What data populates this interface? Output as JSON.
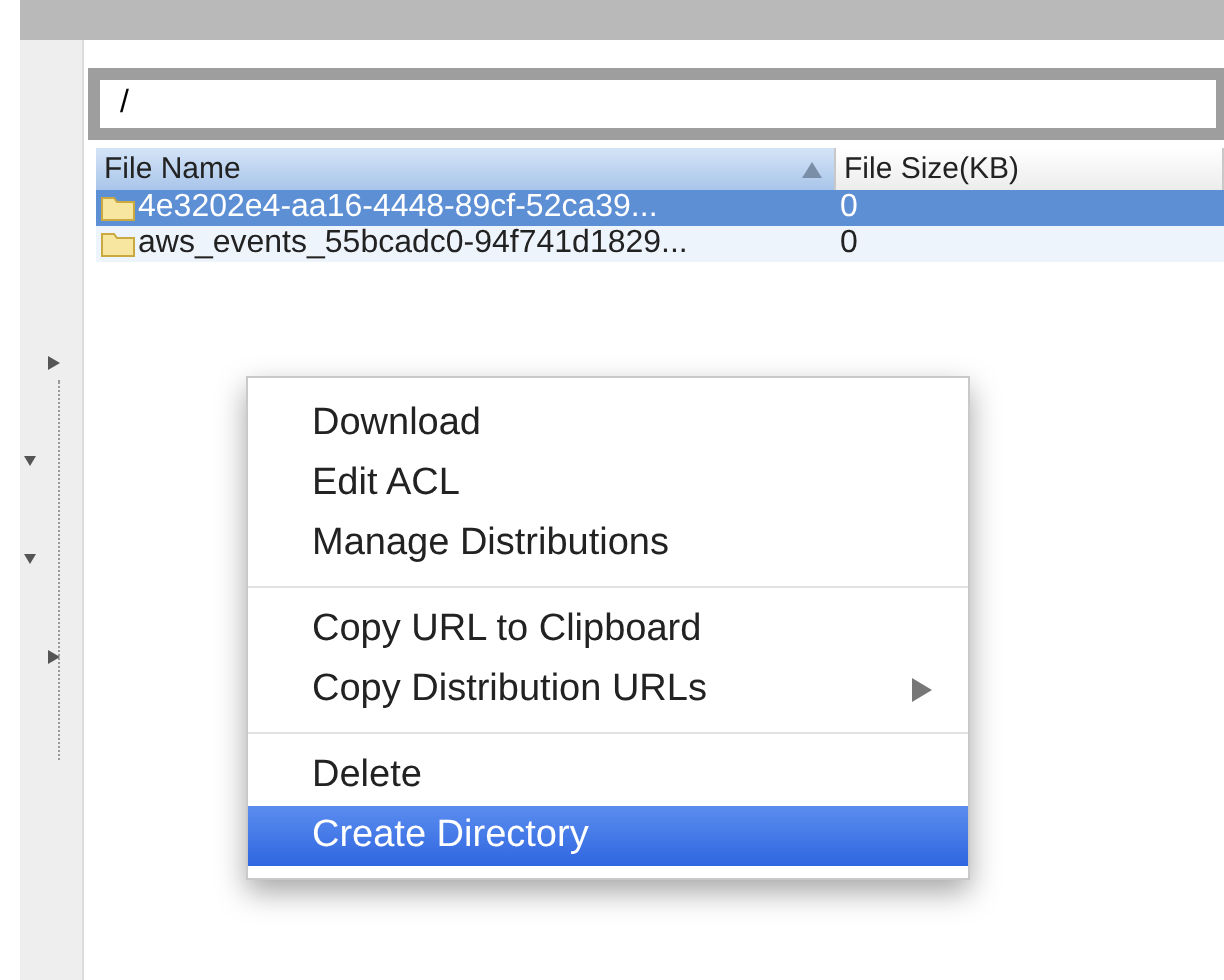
{
  "sidebar": {
    "toggles": [
      {
        "expanded": false
      },
      {
        "expanded": true
      },
      {
        "expanded": true
      },
      {
        "expanded": false
      }
    ]
  },
  "path_field": {
    "value": "/"
  },
  "table": {
    "columns": [
      {
        "label": "File Name",
        "sorted": true
      },
      {
        "label": "File Size(KB)",
        "sorted": false
      }
    ],
    "rows": [
      {
        "name": "4e3202e4-aa16-4448-89cf-52ca39...",
        "size": "0",
        "selected": true
      },
      {
        "name": "aws_events_55bcadc0-94f741d1829...",
        "size": "0",
        "selected": false
      }
    ]
  },
  "context_menu": {
    "groups": [
      [
        {
          "label": "Download",
          "submenu": false,
          "selected": false
        },
        {
          "label": "Edit ACL",
          "submenu": false,
          "selected": false
        },
        {
          "label": "Manage Distributions",
          "submenu": false,
          "selected": false
        }
      ],
      [
        {
          "label": "Copy URL to Clipboard",
          "submenu": false,
          "selected": false
        },
        {
          "label": "Copy Distribution URLs",
          "submenu": true,
          "selected": false
        }
      ],
      [
        {
          "label": "Delete",
          "submenu": false,
          "selected": false
        },
        {
          "label": "Create Directory",
          "submenu": false,
          "selected": true
        }
      ]
    ]
  }
}
